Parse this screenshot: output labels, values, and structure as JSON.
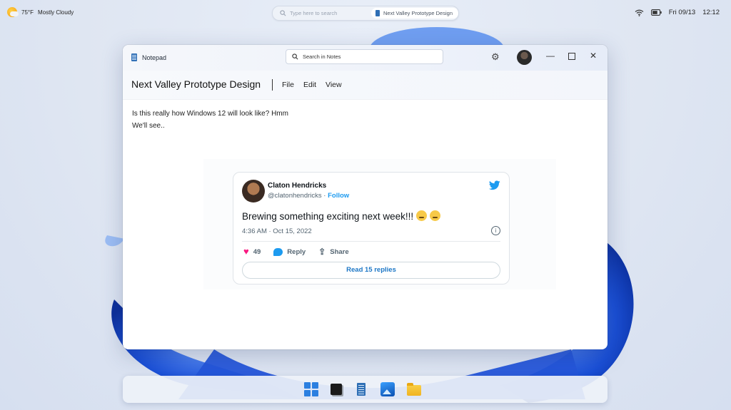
{
  "topbar": {
    "weather": {
      "icon": "partly-cloudy-icon",
      "temp": "75°F",
      "condition": "Mostly Cloudy"
    },
    "search": {
      "placeholder": "Type here to search",
      "recent": "Next Valley Prototype Design"
    },
    "tray": {
      "wifi_icon": "wifi-icon",
      "battery_icon": "battery-icon",
      "date": "Fri 09/13",
      "time": "12:12"
    }
  },
  "window": {
    "app_name": "Notepad",
    "search_placeholder": "Search in Notes",
    "doc_title": "Next Valley Prototype Design",
    "menus": [
      "File",
      "Edit",
      "View"
    ],
    "body_lines": [
      "Is this really how Windows 12 will look like? Hmm",
      "We'll see.."
    ]
  },
  "tweet": {
    "name": "Claton Hendricks",
    "handle": "@clatonhendricks",
    "separator": " · ",
    "follow": "Follow",
    "text": "Brewing something exciting next week!!!",
    "timestamp": "4:36 AM · Oct 15, 2022",
    "likes": "49",
    "reply": "Reply",
    "share": "Share",
    "read_replies": "Read 15 replies"
  },
  "taskbar": {
    "apps": [
      "start-icon",
      "terminal-icon",
      "notepad-icon",
      "photos-icon",
      "file-explorer-icon"
    ]
  },
  "colors": {
    "accent": "#1d9bf0",
    "like": "#f91880",
    "bloom": "#1a4fd6"
  }
}
